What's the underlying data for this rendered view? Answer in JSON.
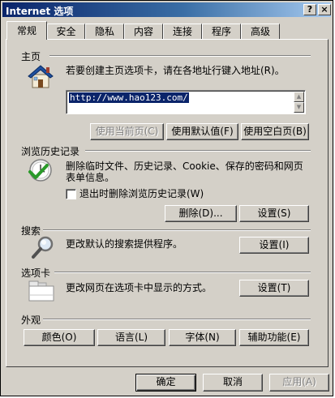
{
  "window": {
    "title": "Internet 选项",
    "help_label": "?",
    "close_label": "×"
  },
  "tabs": [
    {
      "label": "常规",
      "active": true
    },
    {
      "label": "安全"
    },
    {
      "label": "隐私"
    },
    {
      "label": "内容"
    },
    {
      "label": "连接"
    },
    {
      "label": "程序"
    },
    {
      "label": "高级"
    }
  ],
  "home": {
    "section_label": "主页",
    "description": "若要创建主页选项卡，请在各地址行键入地址(R)。",
    "url_value": "http://www.hao123.com/",
    "use_current_label": "使用当前页(C)",
    "use_default_label": "使用默认值(F)",
    "use_blank_label": "使用空白页(B)"
  },
  "history": {
    "section_label": "浏览历史记录",
    "description_line1": "删除临时文件、历史记录、Cookie、保存的密码和网页",
    "description_line2": "表单信息。",
    "checkbox_label": "退出时删除浏览历史记录(W)",
    "delete_label": "删除(D)...",
    "settings_label": "设置(S)"
  },
  "search": {
    "section_label": "搜索",
    "description": "更改默认的搜索提供程序。",
    "settings_label": "设置(I)"
  },
  "tabs_section": {
    "section_label": "选项卡",
    "description": "更改网页在选项卡中显示的方式。",
    "settings_label": "设置(T)"
  },
  "appearance": {
    "section_label": "外观",
    "colors_label": "颜色(O)",
    "languages_label": "语言(L)",
    "fonts_label": "字体(N)",
    "accessibility_label": "辅助功能(E)"
  },
  "footer": {
    "ok_label": "确定",
    "cancel_label": "取消",
    "apply_label": "应用(A)"
  }
}
